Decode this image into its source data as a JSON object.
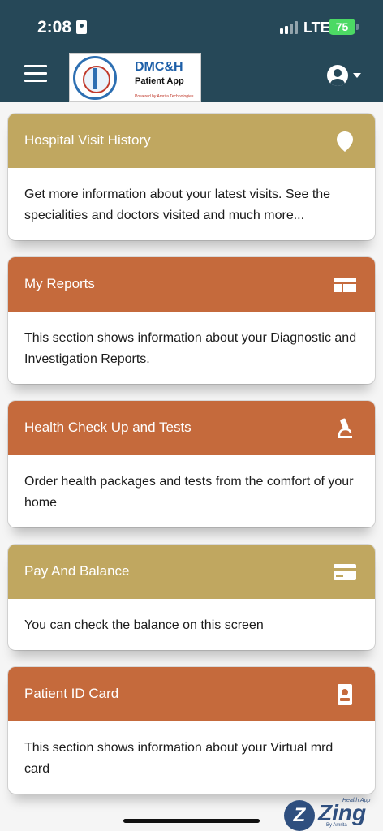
{
  "status_bar": {
    "time": "2:08",
    "network": "LTE",
    "battery": "75"
  },
  "app_bar": {
    "menu_icon": "hamburger-menu-icon",
    "logo": {
      "title": "DMC&H",
      "subtitle": "Patient App",
      "powered_by": "Powered by Amrita Technologies"
    },
    "profile_icon": "account-circle-icon"
  },
  "colors": {
    "header": "#264858",
    "gold": "#c0a760",
    "orange": "#c56a3c"
  },
  "cards": [
    {
      "title": "Hospital Visit History",
      "description": "Get more information about your latest visits. See the specialities and doctors visited and much more...",
      "icon": "location-pin-icon",
      "color": "#c0a760"
    },
    {
      "title": "My Reports",
      "description": "This section shows information about your Diagnostic and Investigation Reports.",
      "icon": "report-layout-icon",
      "color": "#c56a3c"
    },
    {
      "title": "Health Check Up and Tests",
      "description": "Order health packages and tests from the comfort of your home",
      "icon": "microscope-icon",
      "color": "#c56a3c"
    },
    {
      "title": "Pay And Balance",
      "description": "You can check the balance on this screen",
      "icon": "credit-card-icon",
      "color": "#c0a760"
    },
    {
      "title": "Patient ID Card",
      "description": "This section shows information about your Virtual mrd card",
      "icon": "id-badge-icon",
      "color": "#c56a3c"
    }
  ],
  "branding": {
    "circle_letter": "Z",
    "word": "Zing",
    "tagline": "Health App",
    "by": "By Amrita"
  }
}
